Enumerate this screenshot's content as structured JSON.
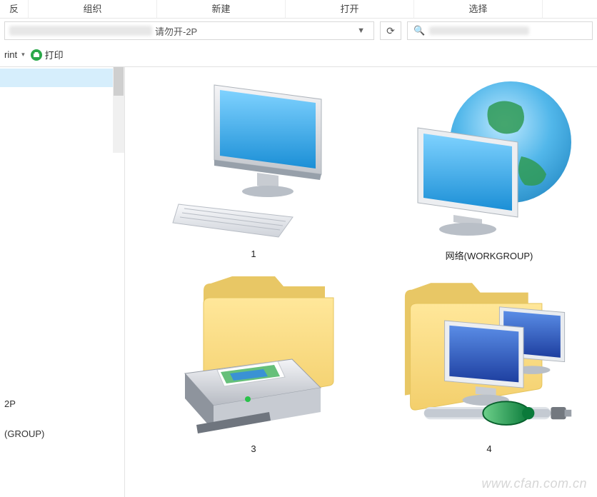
{
  "ribbon": {
    "tabs": [
      "反",
      "组织",
      "新建",
      "打开",
      "选择"
    ]
  },
  "address": {
    "text": "请勿开-2P"
  },
  "search": {
    "icon": "search-icon"
  },
  "toolbar": {
    "print_left": "rint",
    "print_label": "打印"
  },
  "sidebar": {
    "selected_placeholder": "",
    "item_2p": "2P",
    "item_group": "(GROUP)"
  },
  "items": [
    {
      "label": "1"
    },
    {
      "label": "网络(WORKGROUP)"
    },
    {
      "label": "3"
    },
    {
      "label": "4"
    }
  ],
  "watermark": "www.cfan.com.cn"
}
